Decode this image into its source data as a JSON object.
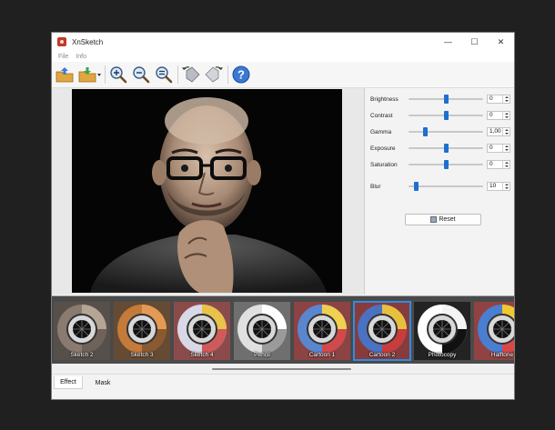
{
  "window": {
    "title": "XnSketch"
  },
  "window_controls": {
    "minimize": "—",
    "maximize": "☐",
    "close": "✕"
  },
  "menu": [
    "File",
    "Info"
  ],
  "toolbar": {
    "icons": [
      "open-icon",
      "save-icon",
      "zoom-in-icon",
      "zoom-out-icon",
      "zoom-fit-icon",
      "rotate-left-icon",
      "rotate-right-icon",
      "help-icon"
    ]
  },
  "adjustments": [
    {
      "label": "Brightness",
      "value": "0",
      "level": 0.5
    },
    {
      "label": "Contrast",
      "value": "0",
      "level": 0.5
    },
    {
      "label": "Gamma",
      "value": "1,00",
      "level": 0.22
    },
    {
      "label": "Exposure",
      "value": "0",
      "level": 0.5
    },
    {
      "label": "Saturation",
      "value": "0",
      "level": 0.5
    },
    {
      "label": "Blur",
      "value": "10",
      "level": 0.1
    }
  ],
  "reset": {
    "label": "Reset"
  },
  "effects": [
    {
      "label": "Sketch 2",
      "palette": [
        "#8a7a70",
        "#b5a595",
        "#6f6258"
      ]
    },
    {
      "label": "Sketch 3",
      "palette": [
        "#c47a3a",
        "#e49a55",
        "#8a5a30"
      ]
    },
    {
      "label": "Sketch 4",
      "palette": [
        "#d8d8e6",
        "#e8c24a",
        "#d05a5a"
      ]
    },
    {
      "label": "Pencil",
      "palette": [
        "#e0e0e0",
        "#ffffff",
        "#9a9a9a"
      ]
    },
    {
      "label": "Cartoon 1",
      "palette": [
        "#5a86d0",
        "#f0d050",
        "#d04a4a"
      ]
    },
    {
      "label": "Cartoon 2",
      "palette": [
        "#4a72c0",
        "#e8c040",
        "#c83c3c"
      ],
      "selected": true
    },
    {
      "label": "Photocopy",
      "palette": [
        "#ffffff",
        "#f4f4f4",
        "#111111"
      ]
    },
    {
      "label": "Halftone",
      "palette": [
        "#4a7ed0",
        "#f0c830",
        "#d84848"
      ]
    }
  ],
  "tabs": [
    "Effect",
    "Mask"
  ]
}
